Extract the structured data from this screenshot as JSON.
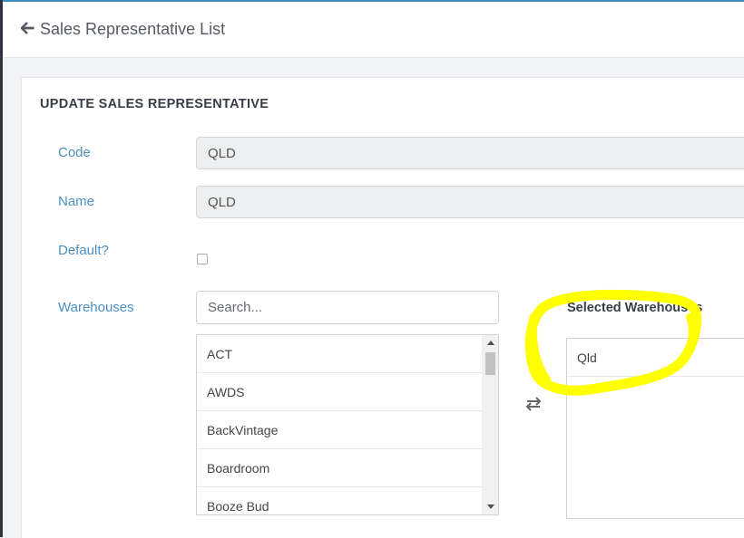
{
  "header": {
    "title": "Sales Representative List"
  },
  "form": {
    "title": "UPDATE SALES REPRESENTATIVE",
    "code": {
      "label": "Code",
      "value": "QLD"
    },
    "name": {
      "label": "Name",
      "value": "QLD"
    },
    "default": {
      "label": "Default?",
      "checked": false
    },
    "warehouses": {
      "label": "Warehouses",
      "search_placeholder": "Search...",
      "available": [
        "ACT",
        "AWDS",
        "BackVintage",
        "Boardroom",
        "Booze Bud"
      ],
      "selected_title": "Selected Warehouses",
      "selected": [
        "Qld"
      ]
    }
  },
  "colors": {
    "accent": "#3c8dbc",
    "label": "#4a90c2",
    "highlight": "#ffff00"
  }
}
